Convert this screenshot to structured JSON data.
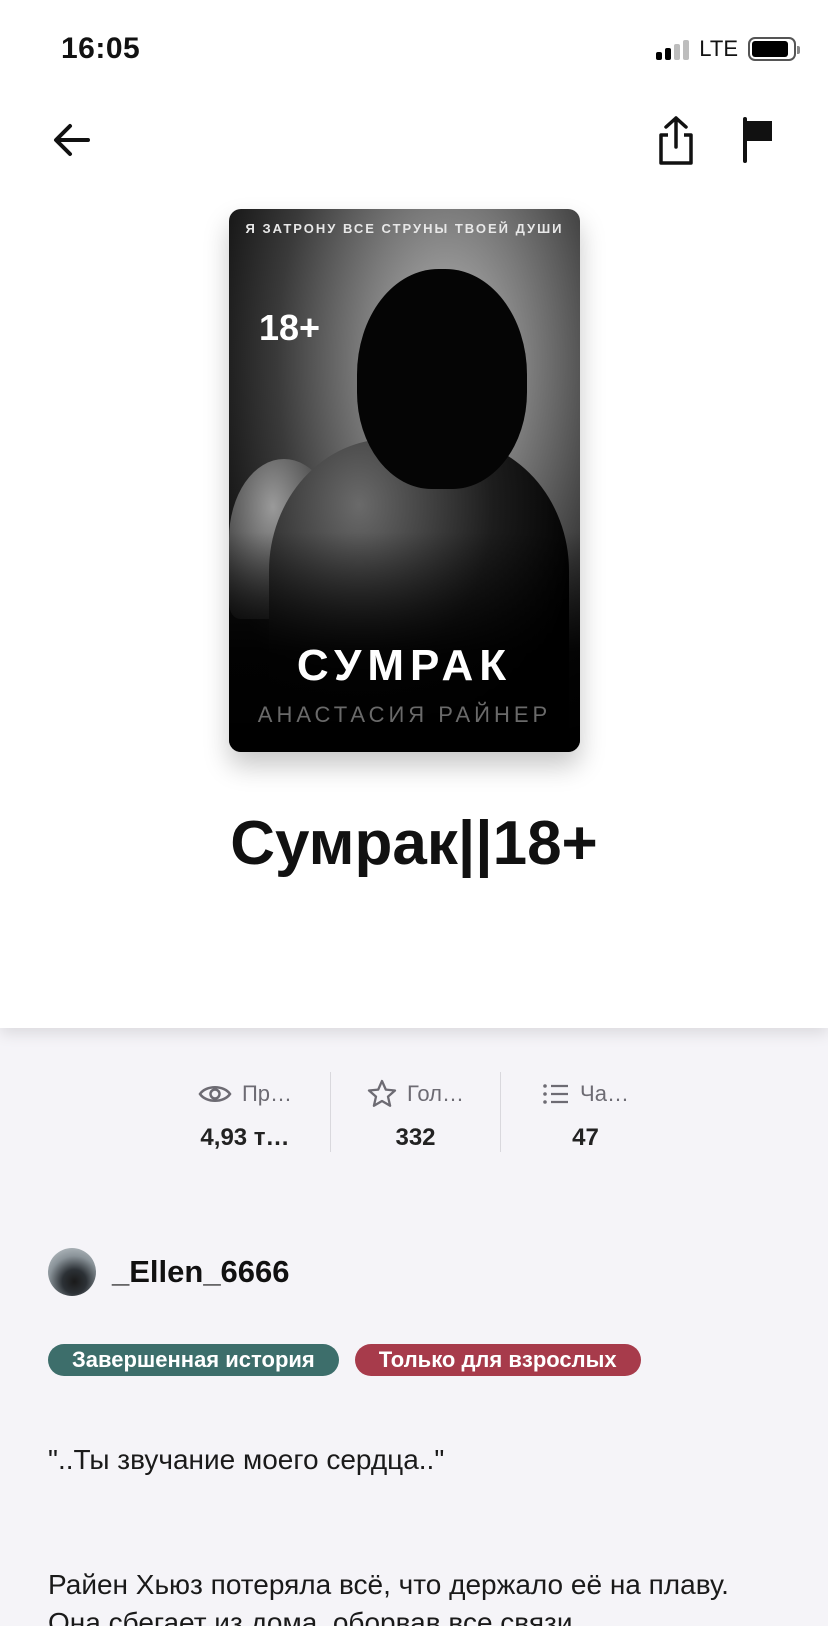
{
  "status_bar": {
    "time": "16:05",
    "network": "LTE",
    "signal_bars_filled": 2,
    "signal_bars_total": 4,
    "battery_level": 0.8
  },
  "nav": {
    "back_icon": "arrow-left-icon",
    "share_icon": "share-icon",
    "report_icon": "flag-icon"
  },
  "cover": {
    "tagline": "Я ЗАТРОНУ ВСЕ СТРУНЫ ТВОЕЙ ДУШИ",
    "age": "18+",
    "title": "СУМРАК",
    "author": "АНАСТАСИЯ РАЙНЕР"
  },
  "book": {
    "title": "Сумрак||18+"
  },
  "stats": [
    {
      "icon": "eye-icon",
      "label": "Пр…",
      "value": "4,93 т…"
    },
    {
      "icon": "star-icon",
      "label": "Гол…",
      "value": "332"
    },
    {
      "icon": "list-icon",
      "label": "Ча…",
      "value": "47"
    }
  ],
  "author": {
    "name": "_Ellen_6666"
  },
  "badges": [
    {
      "label": "Завершенная история",
      "color": "#3d6e6b"
    },
    {
      "label": "Только для взрослых",
      "color": "#a73b4b"
    }
  ],
  "description": {
    "quote": "\"..Ты звучание моего сердца..\"",
    "text": "Райен Хьюз потеряла всё, что держало её на плаву. Она сбегает из дома, оборвав все связи"
  },
  "colors": {
    "background": "#f5f4f8",
    "header_background": "#ffffff",
    "badge_completed": "#3d6e6b",
    "badge_adult": "#a73b4b"
  }
}
